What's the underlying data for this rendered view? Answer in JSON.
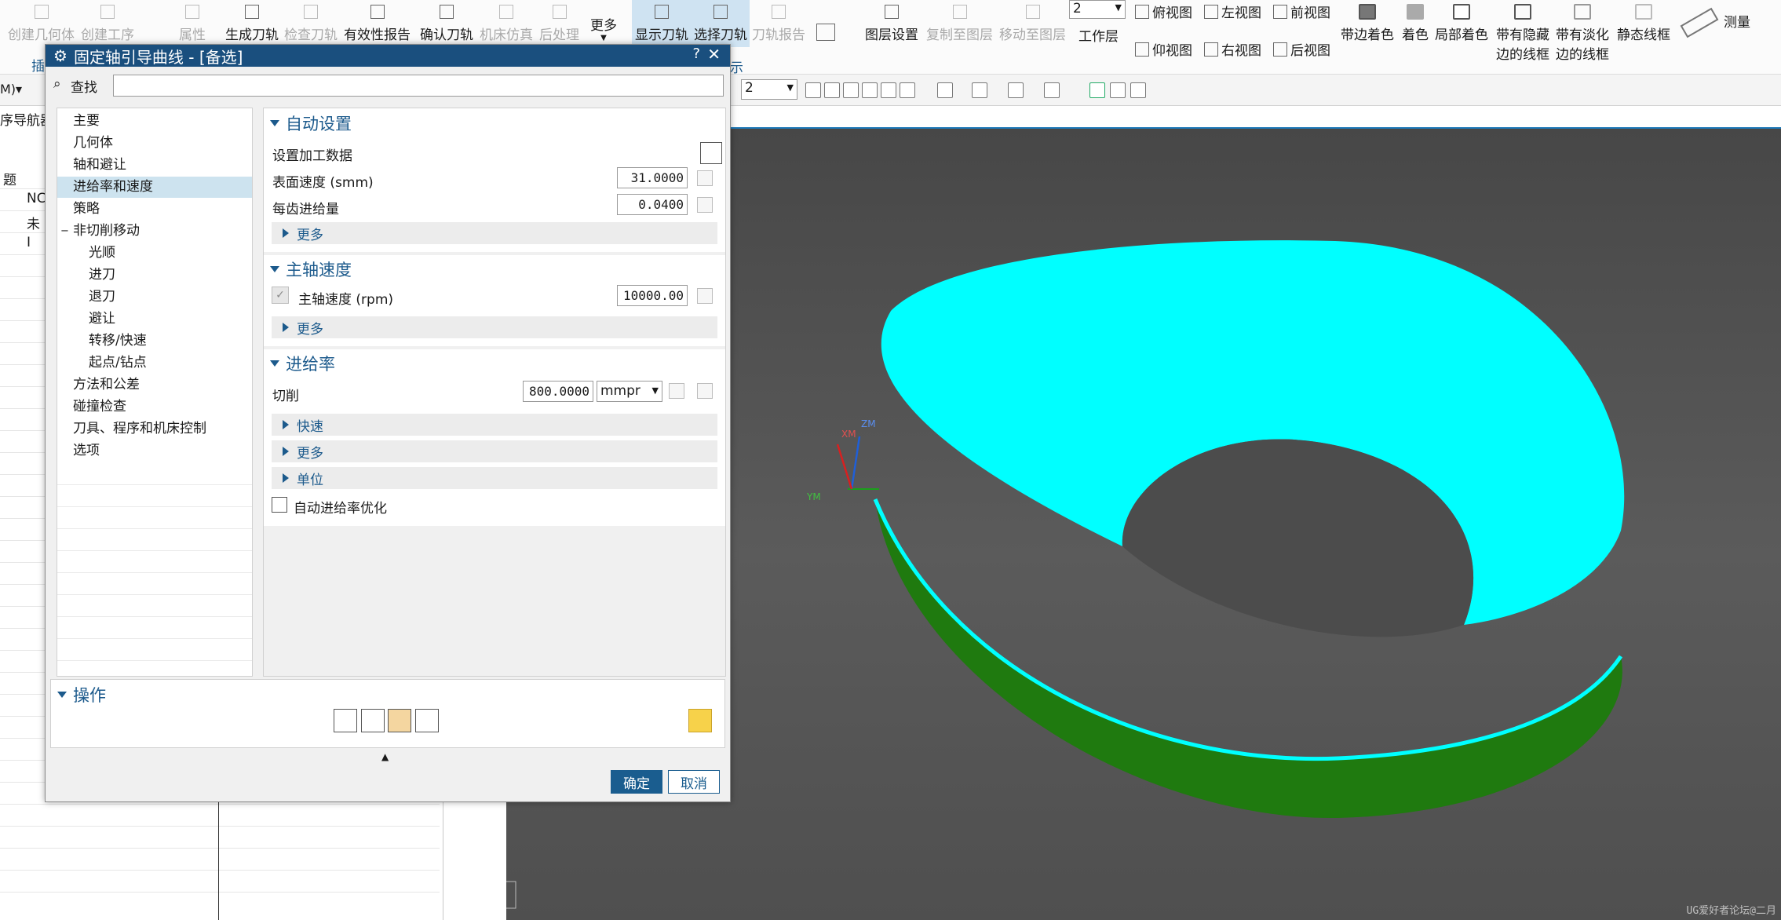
{
  "ribbon": {
    "buttons": [
      {
        "label": "创建几何体",
        "enabled": false
      },
      {
        "label": "创建工序",
        "enabled": false
      },
      {
        "label": "属性",
        "enabled": false
      },
      {
        "label": "生成刀轨",
        "enabled": true
      },
      {
        "label": "检查刀轨",
        "enabled": false
      },
      {
        "label": "有效性报告",
        "enabled": true
      },
      {
        "label": "确认刀轨",
        "enabled": true
      },
      {
        "label": "机床仿真",
        "enabled": false
      },
      {
        "label": "后处理",
        "enabled": false
      },
      {
        "label": "更多",
        "enabled": true
      },
      {
        "label": "显示刀轨",
        "enabled": true
      },
      {
        "label": "选择刀轨",
        "enabled": true
      },
      {
        "label": "刀轨报告",
        "enabled": false
      }
    ],
    "group_fragment_left": "插",
    "group_fragment_right": "示",
    "layer_buttons": [
      {
        "label": "图层设置",
        "enabled": true
      },
      {
        "label": "复制至图层",
        "enabled": false
      },
      {
        "label": "移动至图层",
        "enabled": false
      }
    ],
    "work_layer_value": "2",
    "work_layer_label": "工作层",
    "views": [
      "俯视图",
      "左视图",
      "前视图",
      "仰视图",
      "右视图",
      "后视图"
    ],
    "shading": [
      {
        "line1": "带边着色",
        "line2": ""
      },
      {
        "line1": "着色",
        "line2": ""
      },
      {
        "line1": "局部着色",
        "line2": ""
      },
      {
        "line1": "带有隐藏",
        "line2": "边的线框"
      },
      {
        "line1": "带有淡化",
        "line2": "边的线框"
      },
      {
        "line1": "静态线框",
        "line2": ""
      }
    ],
    "measure": "测量"
  },
  "toolbar2": {
    "left_select": "M)",
    "layer_select": "2"
  },
  "navigator": {
    "title": "序导航器",
    "column": "题",
    "rows": [
      "NC",
      "未",
      "I"
    ]
  },
  "dialog": {
    "title": "固定轴引导曲线 - [备选]",
    "help": "?",
    "close": "✕",
    "search_label": "查找",
    "search_value": "",
    "tree": [
      {
        "label": "主要",
        "sub": false,
        "selected": false
      },
      {
        "label": "几何体",
        "sub": false,
        "selected": false
      },
      {
        "label": "轴和避让",
        "sub": false,
        "selected": false
      },
      {
        "label": "进给率和速度",
        "sub": false,
        "selected": true
      },
      {
        "label": "策略",
        "sub": false,
        "selected": false
      },
      {
        "label": "非切削移动",
        "sub": false,
        "selected": false
      },
      {
        "label": "光顺",
        "sub": true,
        "selected": false
      },
      {
        "label": "进刀",
        "sub": true,
        "selected": false
      },
      {
        "label": "退刀",
        "sub": true,
        "selected": false
      },
      {
        "label": "避让",
        "sub": true,
        "selected": false
      },
      {
        "label": "转移/快速",
        "sub": true,
        "selected": false
      },
      {
        "label": "起点/钻点",
        "sub": true,
        "selected": false
      },
      {
        "label": "方法和公差",
        "sub": false,
        "selected": false
      },
      {
        "label": "碰撞检查",
        "sub": false,
        "selected": false
      },
      {
        "label": "刀具、程序和机床控制",
        "sub": false,
        "selected": false
      },
      {
        "label": "选项",
        "sub": false,
        "selected": false
      }
    ],
    "auto": {
      "title": "自动设置",
      "set_data": "设置加工数据",
      "surface_speed_label": "表面速度 (smm)",
      "surface_speed": "31.0000",
      "feed_per_tooth_label": "每齿进给量",
      "feed_per_tooth": "0.0400",
      "more": "更多"
    },
    "spindle": {
      "title": "主轴速度",
      "speed_label": "主轴速度 (rpm)",
      "speed": "10000.00",
      "checked": true,
      "more": "更多"
    },
    "feed": {
      "title": "进给率",
      "cut_label": "切削",
      "cut_value": "800.0000",
      "unit": "mmpr",
      "rapid": "快速",
      "more": "更多",
      "units": "单位",
      "auto_opt": "自动进给率优化",
      "auto_opt_checked": false
    },
    "ops_title": "操作",
    "ok": "确定",
    "cancel": "取消"
  },
  "viewport": {
    "axes": {
      "xm": "XM",
      "zm": "ZM",
      "ym": "YM"
    },
    "colors": {
      "inner": "#00ffff",
      "outer": "#1f7a0f",
      "background": "#4e4e4e"
    },
    "watermark": "UG爱好者论坛@二月"
  }
}
